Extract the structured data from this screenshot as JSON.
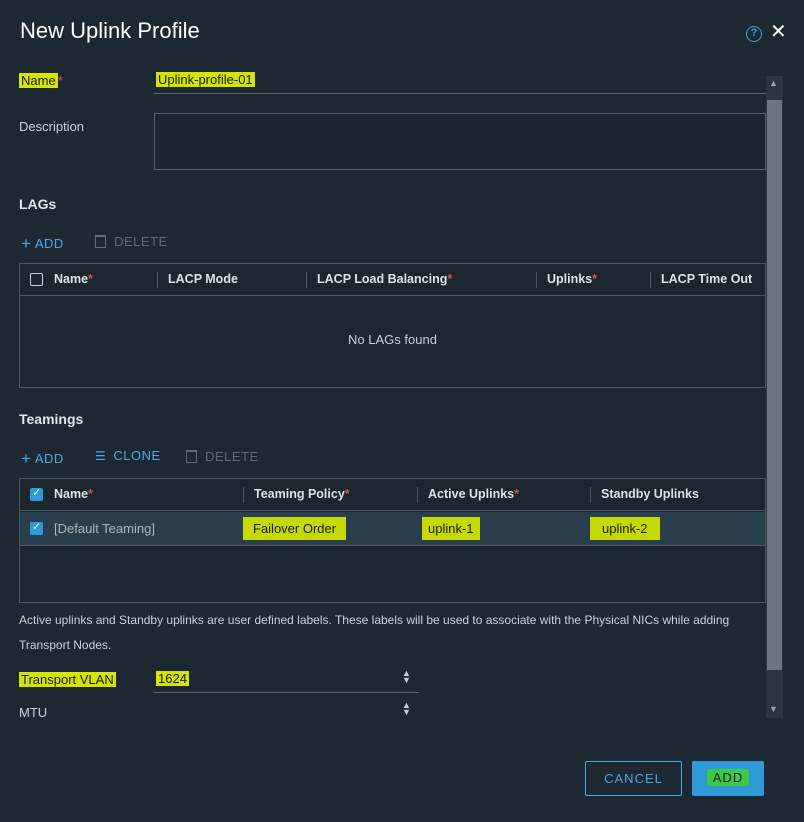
{
  "dialog": {
    "title": "New Uplink Profile",
    "help_glyph": "?",
    "close_glyph": "✕"
  },
  "form": {
    "name_label": "Name",
    "required_mark": "*",
    "name_value": "Uplink-profile-01",
    "description_label": "Description",
    "description_value": "",
    "transport_vlan_label": "Transport VLAN",
    "transport_vlan_value": "1624",
    "mtu_label": "MTU",
    "mtu_value": ""
  },
  "lags": {
    "section_title": "LAGs",
    "add_label": "ADD",
    "delete_label": "DELETE",
    "columns": [
      "Name",
      "LACP Mode",
      "LACP Load Balancing",
      "Uplinks",
      "LACP Time Out"
    ],
    "empty_message": "No LAGs found"
  },
  "teamings": {
    "section_title": "Teamings",
    "add_label": "ADD",
    "clone_label": "CLONE",
    "delete_label": "DELETE",
    "columns": [
      "Name",
      "Teaming Policy",
      "Active Uplinks",
      "Standby Uplinks"
    ],
    "rows": [
      {
        "name": "[Default Teaming]",
        "teaming_policy": "Failover Order",
        "active_uplinks": "uplink-1",
        "standby_uplinks": "uplink-2"
      }
    ],
    "note": "Active uplinks and Standby uplinks are user defined labels. These labels will be used to associate with the Physical NICs while adding Transport Nodes."
  },
  "footer": {
    "cancel_label": "CANCEL",
    "add_label": "ADD"
  },
  "colors": {
    "background": "#1d2932",
    "accent": "#2e9ad8",
    "highlight": "#d4e600",
    "required": "#e05050"
  }
}
